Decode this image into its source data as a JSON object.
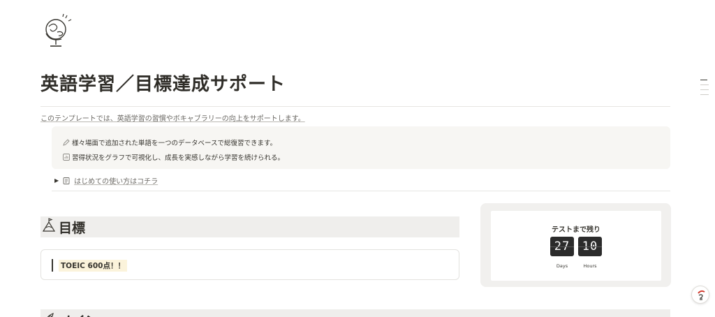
{
  "page": {
    "icon": "globe-icon",
    "title": "英語学習／目標達成サポート",
    "intro": "このテンプレートでは、英語学習の習慣やボキャブラリーの向上をサポートします。"
  },
  "callout": {
    "line1_icon": "pencil-icon",
    "line1": "様々場面で追加された単語を一つのデータベースで総復習できます。",
    "line2_icon": "chart-icon",
    "line2": "習得状況をグラフで可視化し、成長を実感しながら学習を続けられる。"
  },
  "toggle": {
    "icon": "book-icon",
    "label": "はじめての使い方はコチラ"
  },
  "goal": {
    "heading_icon": "mountain-flag-icon",
    "heading": "目標",
    "text": "TOEIC 600点！！"
  },
  "countdown": {
    "title": "テストまで残り",
    "days": "27",
    "hours": "10",
    "days_label": "Days",
    "hours_label": "Hours"
  },
  "main_section": {
    "heading_icon": "rocket-icon",
    "heading": "メイン"
  },
  "colors": {
    "text": "#37352f",
    "callout_bg": "#f7f6f3",
    "heading_bg": "#efeeec",
    "highlight": "#fbf3db",
    "timer_digit_bg": "#2b2b2b"
  }
}
